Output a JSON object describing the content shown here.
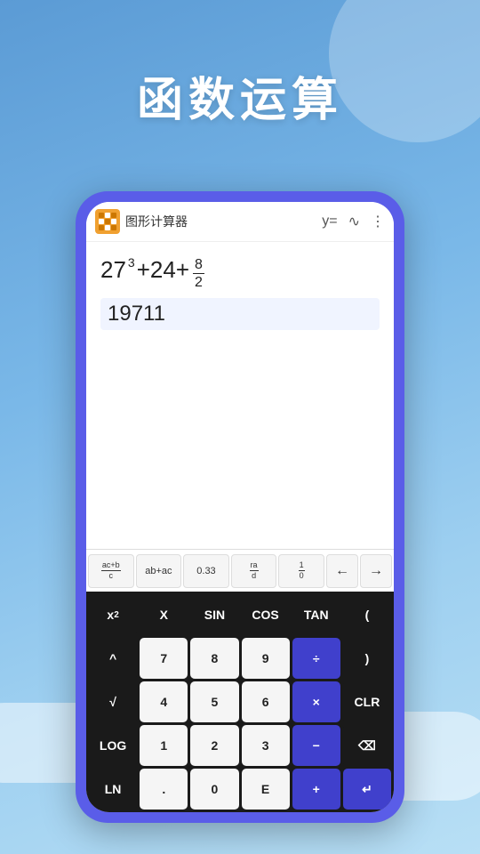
{
  "page": {
    "title": "函数运算",
    "bg_color": "#5b9bd5"
  },
  "app": {
    "name": "图形计算器",
    "icon_label": "图形计算器"
  },
  "header": {
    "title": "图形计算器",
    "btn_y": "y=",
    "btn_wave": "∿",
    "btn_more": "⋮"
  },
  "display": {
    "expression": "27³+24+8/2",
    "result": "19711"
  },
  "scroll_bar": {
    "btn1": "ac+b/c",
    "btn2": "ab+ac",
    "btn3": "0.33",
    "btn4": "ra/d",
    "btn5": "1/0",
    "nav_left": "←",
    "nav_right": "→"
  },
  "keyboard": {
    "row1": [
      {
        "label": "x²",
        "type": "dark"
      },
      {
        "label": "X",
        "type": "dark"
      },
      {
        "label": "SIN",
        "type": "dark"
      },
      {
        "label": "COS",
        "type": "dark"
      },
      {
        "label": "TAN",
        "type": "dark"
      },
      {
        "label": "(",
        "type": "dark"
      }
    ],
    "row2": [
      {
        "label": "^",
        "type": "dark"
      },
      {
        "label": "7",
        "type": "white"
      },
      {
        "label": "8",
        "type": "white"
      },
      {
        "label": "9",
        "type": "white"
      },
      {
        "label": "÷",
        "type": "blue"
      },
      {
        "label": ")",
        "type": "dark"
      }
    ],
    "row3": [
      {
        "label": "√",
        "type": "dark"
      },
      {
        "label": "4",
        "type": "white"
      },
      {
        "label": "5",
        "type": "white"
      },
      {
        "label": "6",
        "type": "white"
      },
      {
        "label": "×",
        "type": "blue"
      },
      {
        "label": "CLR",
        "type": "dark"
      }
    ],
    "row4": [
      {
        "label": "LOG",
        "type": "dark"
      },
      {
        "label": "1",
        "type": "white"
      },
      {
        "label": "2",
        "type": "white"
      },
      {
        "label": "3",
        "type": "white"
      },
      {
        "label": "−",
        "type": "blue"
      },
      {
        "label": "⌫",
        "type": "dark"
      }
    ],
    "row5": [
      {
        "label": "LN",
        "type": "dark"
      },
      {
        "label": ".",
        "type": "white"
      },
      {
        "label": "0",
        "type": "white"
      },
      {
        "label": "E",
        "type": "white"
      },
      {
        "label": "+",
        "type": "blue"
      },
      {
        "label": "↵",
        "type": "blue"
      }
    ]
  }
}
